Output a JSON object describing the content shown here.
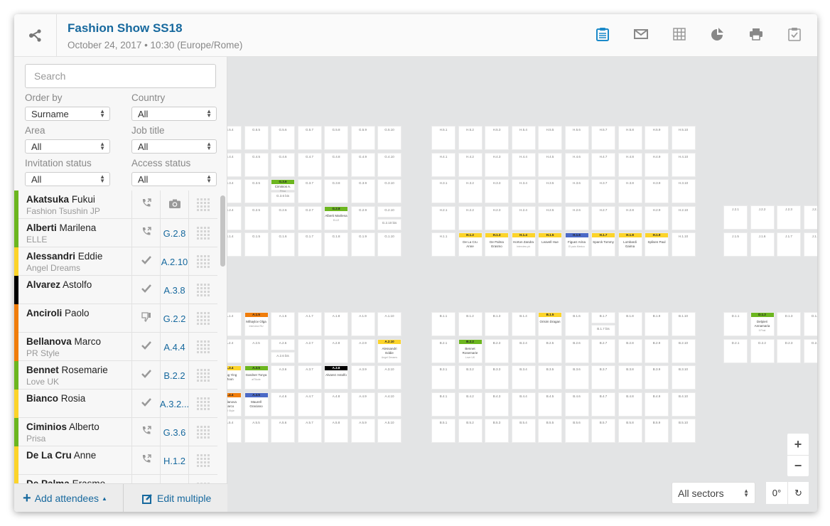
{
  "header": {
    "title": "Fashion Show SS18",
    "subtitle": "October 24, 2017 • 10:30 (Europe/Rome)",
    "toolbar": [
      "clipboard-list-icon",
      "mail-icon",
      "grid-icon",
      "pie-chart-icon",
      "print-icon",
      "clipboard-check-icon"
    ],
    "active_color": "#1b8ac9"
  },
  "sidebar": {
    "search_placeholder": "Search",
    "filters": [
      {
        "label": "Order by",
        "value": "Surname"
      },
      {
        "label": "Country",
        "value": "All"
      },
      {
        "label": "Area",
        "value": "All"
      },
      {
        "label": "Job title",
        "value": "All"
      },
      {
        "label": "Invitation status",
        "value": "All"
      },
      {
        "label": "Access status",
        "value": "All"
      }
    ],
    "attendees": [
      {
        "surname": "Akatsuka",
        "first": "Fukui",
        "company": "Fashion Tsushin JP",
        "color": "#6cb61f",
        "status": "phone",
        "seat": "",
        "seat_icon": "camera"
      },
      {
        "surname": "Alberti",
        "first": "Marilena",
        "company": "ELLE",
        "color": "#6cb61f",
        "status": "phone",
        "seat": "G.2.8"
      },
      {
        "surname": "Alessandri",
        "first": "Eddie",
        "company": "Angel Dreams",
        "color": "#fcd42a",
        "status": "check",
        "seat": "A.2.10"
      },
      {
        "surname": "Alvarez",
        "first": "Astolfo",
        "company": "",
        "color": "#000000",
        "status": "check",
        "seat": "A.3.8"
      },
      {
        "surname": "Anciroli",
        "first": "Paolo",
        "company": "",
        "color": "#f07d0b",
        "status": "thumbs-down",
        "seat": "G.2.2"
      },
      {
        "surname": "Bellanova",
        "first": "Marco",
        "company": "PR Style",
        "color": "#f07d0b",
        "status": "check",
        "seat": "A.4.4"
      },
      {
        "surname": "Bennet",
        "first": "Rosemarie",
        "company": "Love UK",
        "color": "#6cb61f",
        "status": "check",
        "seat": "B.2.2"
      },
      {
        "surname": "Bianco",
        "first": "Rosia",
        "company": "",
        "color": "#fcd42a",
        "status": "check",
        "seat": "A.3.2..."
      },
      {
        "surname": "Ciminios",
        "first": "Alberto",
        "company": "Prisa",
        "color": "#6cb61f",
        "status": "phone",
        "seat": "G.3.6"
      },
      {
        "surname": "De La Cru",
        "first": "Anne",
        "company": "",
        "color": "#fcd42a",
        "status": "phone",
        "seat": "H.1.2"
      },
      {
        "surname": "De Palma",
        "first": "Erasmo",
        "company": "",
        "color": "#fcd42a",
        "status": "",
        "seat": ""
      }
    ],
    "footer": {
      "add_label": "Add attendees",
      "edit_label": "Edit multiple"
    }
  },
  "map": {
    "sections": [
      {
        "id": "G",
        "rows": [
          5,
          4,
          3,
          2,
          1
        ],
        "cols": [
          4,
          5,
          6,
          7,
          8,
          9,
          10
        ]
      },
      {
        "id": "H",
        "rows": [
          5,
          4,
          3,
          2,
          1
        ],
        "cols": [
          1,
          2,
          3,
          4,
          5,
          6,
          7,
          8,
          9,
          10
        ]
      },
      {
        "id": "J",
        "rows": [
          2,
          1
        ],
        "cols": [
          1,
          2,
          3,
          4
        ]
      },
      {
        "id": "A",
        "rows": [
          1,
          2,
          3,
          4,
          5
        ],
        "cols": [
          4,
          5,
          6,
          7,
          8,
          9,
          10
        ]
      },
      {
        "id": "B",
        "rows": [
          1,
          2,
          3,
          4,
          5
        ],
        "cols": [
          1,
          2,
          3,
          4,
          5,
          6,
          7,
          8,
          9,
          10
        ]
      },
      {
        "id": "D",
        "rows": [
          1,
          2
        ],
        "cols": [
          1,
          2,
          3,
          4
        ]
      }
    ],
    "j_row1_labels": [
      "J.1.5",
      "J.1.6",
      "J.1.7",
      "J.1.8"
    ],
    "assigned": {
      "G.3.6": {
        "color": "#6cb61f",
        "name": "Ciminios A.",
        "company": "Prisa",
        "bis": "G.3.6 bis"
      },
      "G.2.8": {
        "color": "#6cb61f",
        "name": "Alberti Marilena",
        "company": "ELLE"
      },
      "G.2.10": {
        "bis": "G.2.10 bis"
      },
      "H.1.2": {
        "color": "#fcd42a",
        "name": "De La Cru Anne"
      },
      "H.1.3": {
        "color": "#fcd42a",
        "name": "De Palma Erasmo"
      },
      "H.1.4": {
        "color": "#fcd42a",
        "name": "Horton Zandra",
        "company": "Interview ph"
      },
      "H.1.5": {
        "color": "#fcd42a",
        "name": "Leavell Hue"
      },
      "H.1.6": {
        "color": "#4b69c6",
        "name": "Figuez Arina",
        "company": "El país Mexico"
      },
      "H.1.7": {
        "color": "#fcd42a",
        "name": "Sparck Tommy"
      },
      "H.1.8": {
        "color": "#fcd42a",
        "name": "Lombardi Gaima"
      },
      "H.1.9": {
        "color": "#fcd42a",
        "name": "Splisen Paul"
      },
      "A.1.5": {
        "color": "#f07d0b",
        "name": "Mihaylov Olga",
        "company": "Interview RU"
      },
      "A.2.6": {
        "bis": "A.2.6 bis"
      },
      "A.2.10": {
        "color": "#fcd42a",
        "name": "Alessandri Eddie",
        "company": "Angel Dreams"
      },
      "A.3.4": {
        "color": "#fcd42a",
        "name": "Song Ying Moon"
      },
      "A.3.5": {
        "color": "#6cb61f",
        "name": "Gardner Tonya",
        "company": "atTitude"
      },
      "A.3.8": {
        "color": "#000000",
        "name": "Alvarez Astolfo",
        "dark": true
      },
      "A.4.4": {
        "color": "#f07d0b",
        "name": "Bellanova Marco",
        "company": "PR Style"
      },
      "A.4.5": {
        "color": "#4b69c6",
        "name": "Maurell Graciano"
      },
      "B.1.5": {
        "color": "#fcd42a",
        "name": "Orisim Dragan"
      },
      "B.1.7": {
        "bis": "B.1.7 bis"
      },
      "B.2.2": {
        "color": "#6cb61f",
        "name": "Bennet Rosemarie",
        "company": "Love UK"
      },
      "D.1.2": {
        "color": "#6cb61f",
        "name": "Delpieri Annamaria",
        "company": "Il Post"
      }
    },
    "sector_select": "All sectors",
    "rotation": "0°"
  }
}
